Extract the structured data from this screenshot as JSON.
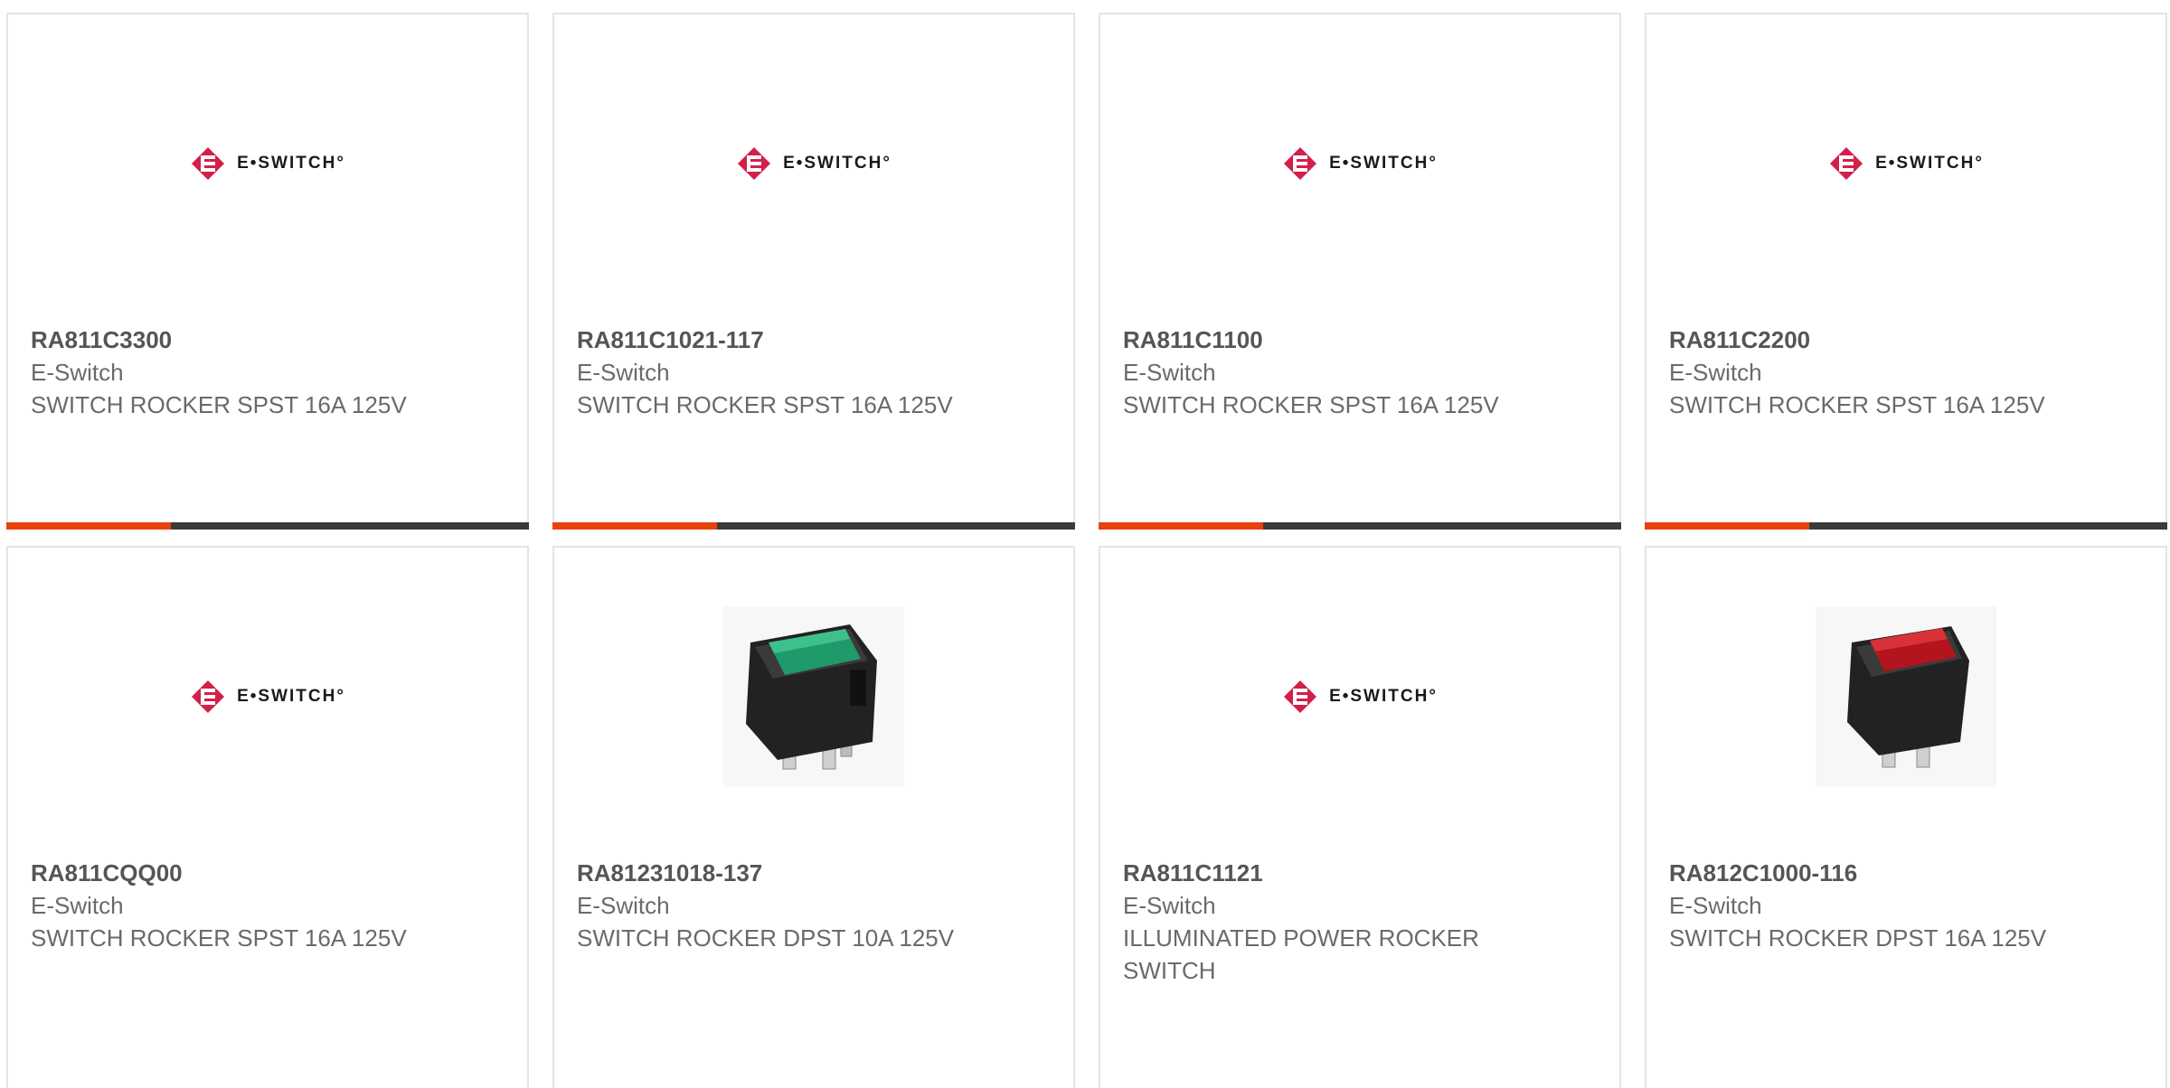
{
  "brand": {
    "logo_text": "E•SWITCH°",
    "logo_color": "#d31f4a",
    "accent_color": "#e8420c",
    "bar_color": "#3a3a3a"
  },
  "products": [
    {
      "part": "RA811C3300",
      "mfr": "E-Switch",
      "desc": "SWITCH ROCKER SPST 16A 125V",
      "image": "eswitch-logo"
    },
    {
      "part": "RA811C1021-117",
      "mfr": "E-Switch",
      "desc": "SWITCH ROCKER SPST 16A 125V",
      "image": "eswitch-logo"
    },
    {
      "part": "RA811C1100",
      "mfr": "E-Switch",
      "desc": "SWITCH ROCKER SPST 16A 125V",
      "image": "eswitch-logo"
    },
    {
      "part": "RA811C2200",
      "mfr": "E-Switch",
      "desc": "SWITCH ROCKER SPST 16A 125V",
      "image": "eswitch-logo"
    },
    {
      "part": "RA811CQQ00",
      "mfr": "E-Switch",
      "desc": "SWITCH ROCKER SPST 16A 125V",
      "image": "eswitch-logo"
    },
    {
      "part": "RA81231018-137",
      "mfr": "E-Switch",
      "desc": "SWITCH ROCKER DPST 10A 125V",
      "image": "green-rocker-switch",
      "rocker_color": "#1f9a6a"
    },
    {
      "part": "RA811C1121",
      "mfr": "E-Switch",
      "desc": "ILLUMINATED POWER ROCKER SWITCH",
      "image": "eswitch-logo"
    },
    {
      "part": "RA812C1000-116",
      "mfr": "E-Switch",
      "desc": "SWITCH ROCKER DPST 16A 125V",
      "image": "red-rocker-switch",
      "rocker_color": "#b3141d"
    }
  ]
}
